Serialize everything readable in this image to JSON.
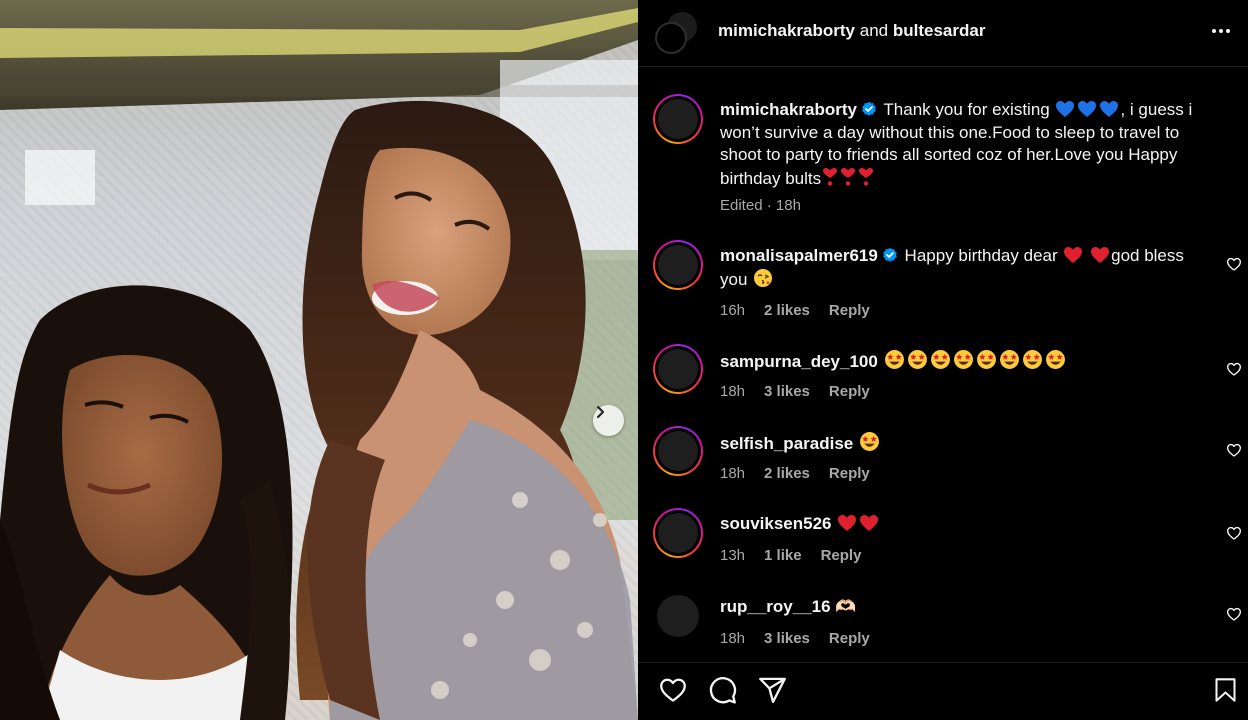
{
  "header": {
    "user1": "mimichakraborty",
    "joiner": "and",
    "user2": "bultesardar"
  },
  "caption": {
    "username": "mimichakraborty",
    "text_a": "Thank you for existing",
    "text_b": ", i guess i won’t survive a day without this one.Food to sleep to travel to shoot to party to friends all sorted coz of her.Love you Happy birthday bults",
    "edited": "Edited",
    "time": "18h",
    "emojis": [
      "blue-heart",
      "blue-heart",
      "blue-heart",
      "heart-exclamation",
      "heart-exclamation",
      "heart-exclamation"
    ]
  },
  "comments": [
    {
      "username": "monalisapalmer619",
      "text_a": "Happy birthday dear",
      "text_b": "god bless you",
      "time": "16h",
      "likes": "2 likes",
      "reply": "Reply",
      "emojis": [
        "red-heart",
        "red-heart",
        "kissing-face"
      ]
    },
    {
      "username": "sampurna_dey_100",
      "time": "18h",
      "likes": "3 likes",
      "reply": "Reply",
      "emojis": [
        "star-struck",
        "star-struck",
        "star-struck",
        "star-struck",
        "star-struck",
        "star-struck",
        "star-struck",
        "star-struck"
      ]
    },
    {
      "username": "selfish_paradise",
      "time": "18h",
      "likes": "2 likes",
      "reply": "Reply",
      "emojis": [
        "star-struck"
      ]
    },
    {
      "username": "souviksen526",
      "time": "13h",
      "likes": "1 like",
      "reply": "Reply",
      "emojis": [
        "red-heart",
        "red-heart"
      ]
    },
    {
      "username": "rup__roy__16",
      "text": "🫶🏻",
      "time": "18h",
      "likes": "3 likes",
      "reply": "Reply"
    }
  ],
  "icons": [
    "more-icon",
    "next-arrow-icon",
    "verified-icon",
    "like-icon",
    "comment-icon",
    "share-icon",
    "save-icon"
  ],
  "colors": {
    "background": "#000000",
    "text": "#f5f5f5",
    "muted": "#a8a8a8",
    "verified": "#0095f6",
    "story_ring": "#d3119c"
  }
}
